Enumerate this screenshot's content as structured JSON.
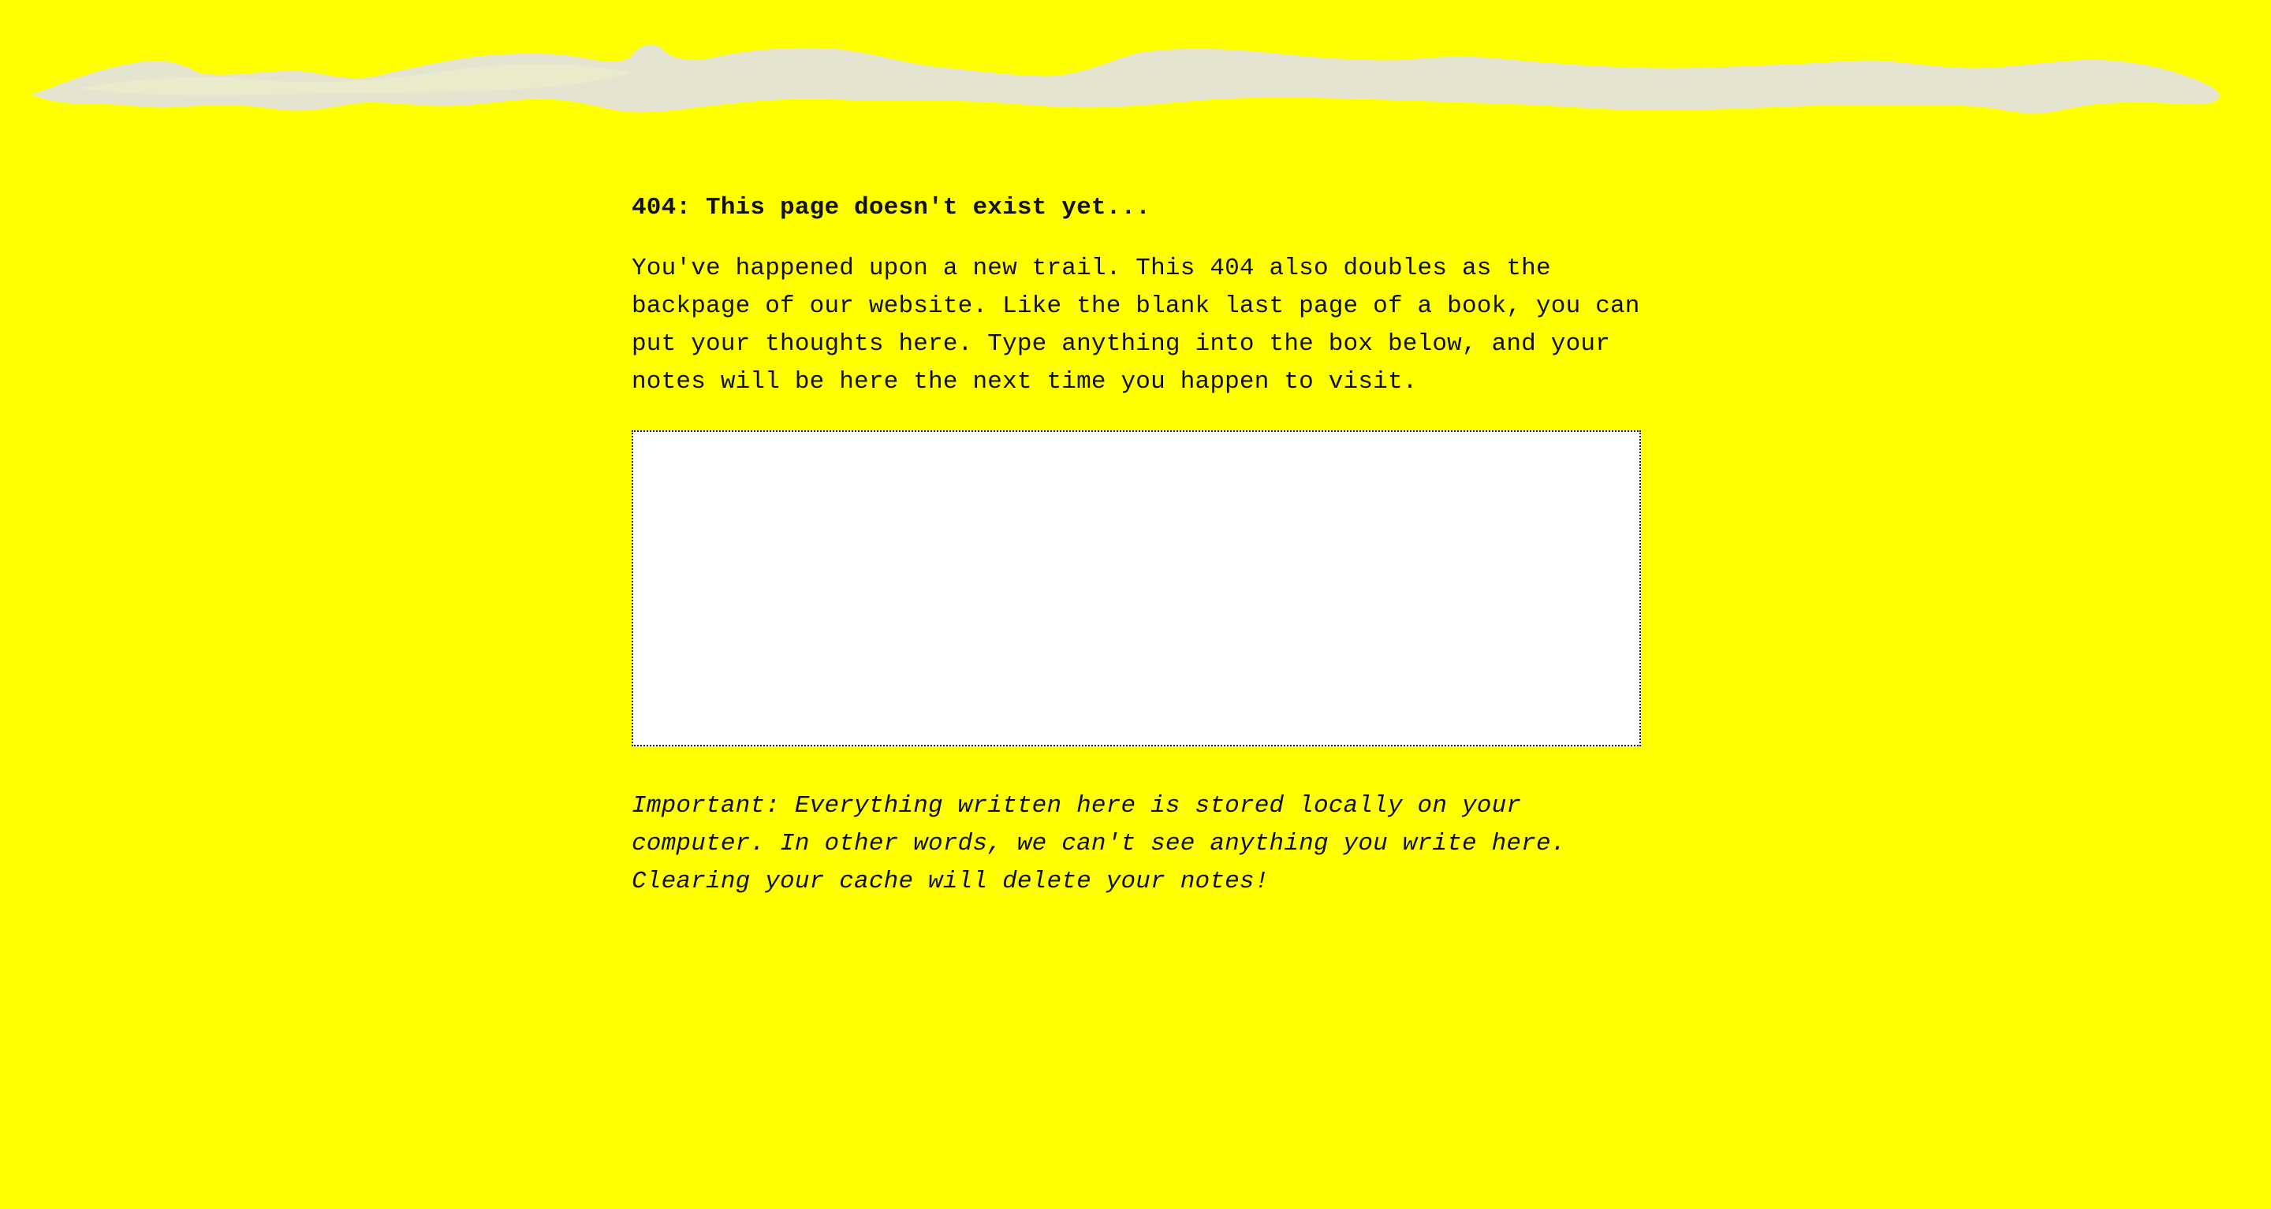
{
  "page": {
    "background_color": "#ffff00",
    "brush_stroke_color": "#e2e2e2"
  },
  "content": {
    "heading": "404: This page doesn't exist yet...",
    "intro": "You've happened upon a new trail. This 404 also doubles as the backpage of our website. Like the blank last page of a book, you can put your thoughts here. Type anything into the box below, and your notes will be here the next time you happen to visit.",
    "notes_value": "",
    "notice": "Important: Everything written here is stored locally on your computer. In other words, we can't see anything you write here. Clearing your cache will delete your notes!"
  }
}
